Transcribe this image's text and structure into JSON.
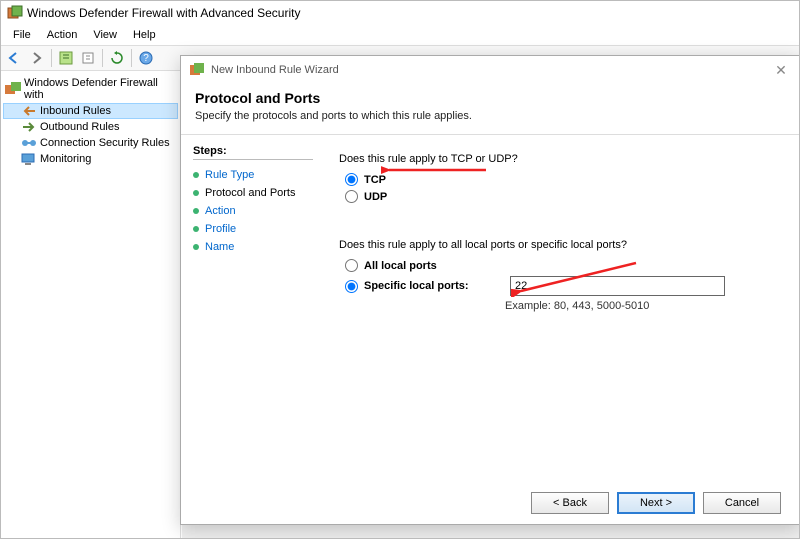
{
  "window": {
    "title": "Windows Defender Firewall with Advanced Security"
  },
  "menus": {
    "file": "File",
    "action": "Action",
    "view": "View",
    "help": "Help"
  },
  "tree": {
    "root": "Windows Defender Firewall with",
    "items": [
      {
        "label": "Inbound Rules"
      },
      {
        "label": "Outbound Rules"
      },
      {
        "label": "Connection Security Rules"
      },
      {
        "label": "Monitoring"
      }
    ]
  },
  "wizard": {
    "title": "New Inbound Rule Wizard",
    "heading": "Protocol and Ports",
    "subheading": "Specify the protocols and ports to which this rule applies.",
    "steps_label": "Steps:",
    "steps": [
      {
        "label": "Rule Type"
      },
      {
        "label": "Protocol and Ports"
      },
      {
        "label": "Action"
      },
      {
        "label": "Profile"
      },
      {
        "label": "Name"
      }
    ],
    "q1": "Does this rule apply to TCP or UDP?",
    "opt_tcp": "TCP",
    "opt_udp": "UDP",
    "q2": "Does this rule apply to all local ports or specific local ports?",
    "opt_all": "All local ports",
    "opt_specific": "Specific local ports:",
    "port_value": "22",
    "port_example": "Example: 80, 443, 5000-5010",
    "buttons": {
      "back": "< Back",
      "next": "Next >",
      "cancel": "Cancel"
    }
  }
}
